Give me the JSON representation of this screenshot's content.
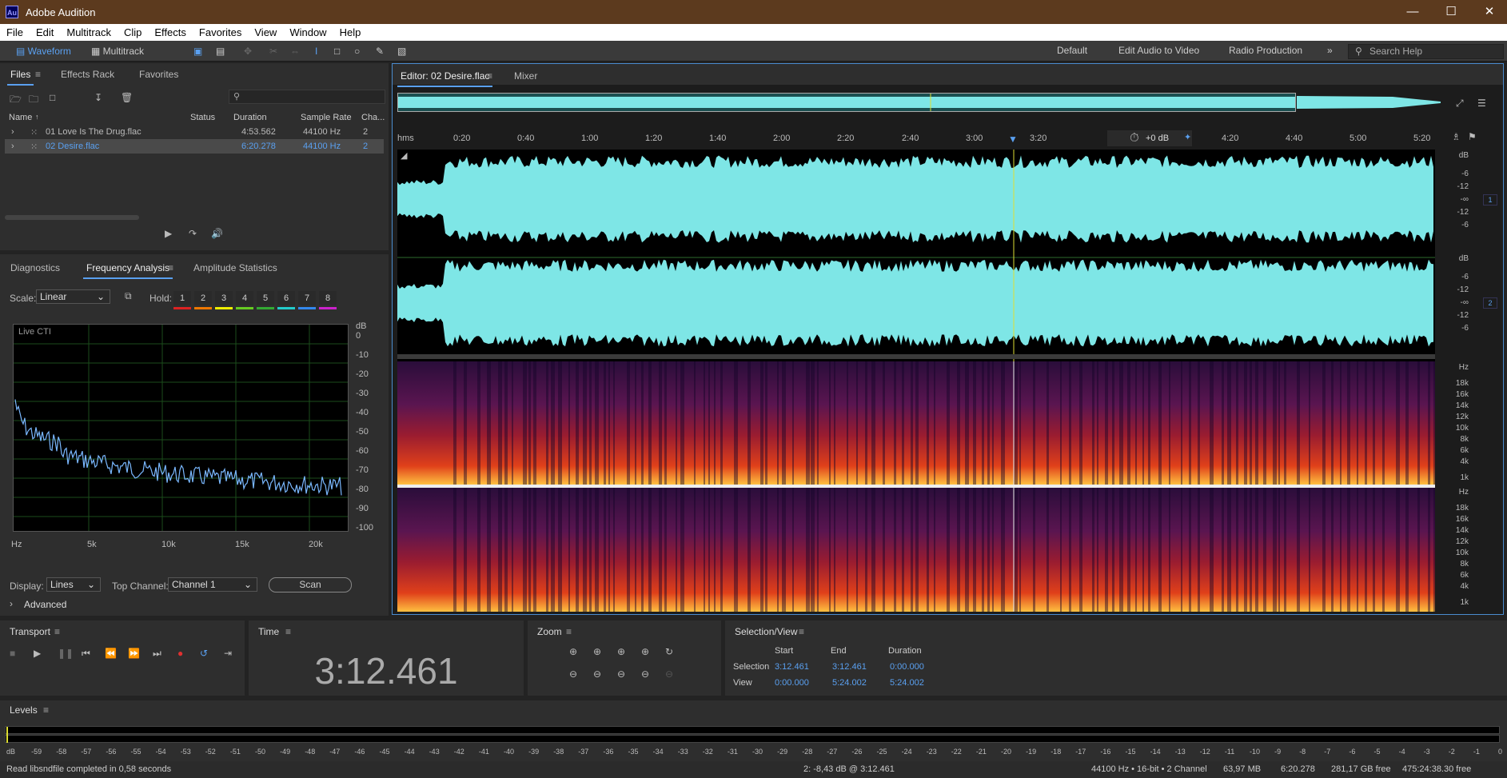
{
  "app": {
    "title": "Adobe Audition",
    "logo": "Au"
  },
  "menu": [
    "File",
    "Edit",
    "Multitrack",
    "Clip",
    "Effects",
    "Favorites",
    "View",
    "Window",
    "Help"
  ],
  "toolbar": {
    "waveform_label": "Waveform",
    "multitrack_label": "Multitrack",
    "workspaces": [
      "Default",
      "Edit Audio to Video",
      "Radio Production"
    ],
    "search_placeholder": "Search Help"
  },
  "files_panel": {
    "tabs": [
      "Files",
      "Effects Rack",
      "Favorites"
    ],
    "columns": [
      "Name",
      "Status",
      "Duration",
      "Sample Rate",
      "Cha..."
    ],
    "rows": [
      {
        "name": "01 Love Is The Drug.flac",
        "duration": "4:53.562",
        "rate": "44100 Hz",
        "ch": "2"
      },
      {
        "name": "02 Desire.flac",
        "duration": "6:20.278",
        "rate": "44100 Hz",
        "ch": "2"
      }
    ]
  },
  "analysis_panel": {
    "tabs": [
      "Diagnostics",
      "Frequency Analysis",
      "Amplitude Statistics"
    ],
    "scale_label": "Scale:",
    "scale_value": "Linear",
    "hold_label": "Hold:",
    "hold_buttons": [
      "1",
      "2",
      "3",
      "4",
      "5",
      "6",
      "7",
      "8"
    ],
    "hold_colors": [
      "#d22",
      "#e70",
      "#ee0",
      "#6c2",
      "#3a3",
      "#2cc",
      "#38e",
      "#c2c"
    ],
    "plot_label": "Live CTI",
    "db_ticks": [
      "dB",
      "0",
      "-10",
      "-20",
      "-30",
      "-40",
      "-50",
      "-60",
      "-70",
      "-80",
      "-90",
      "-100"
    ],
    "freq_ticks": [
      "Hz",
      "5k",
      "10k",
      "15k",
      "20k"
    ],
    "display_label": "Display:",
    "display_value": "Lines",
    "channel_label": "Top Channel:",
    "channel_value": "Channel 1",
    "scan_label": "Scan",
    "advanced_label": "Advanced"
  },
  "editor": {
    "tabs": [
      "Editor: 02 Desire.flac",
      "Mixer"
    ],
    "ruler": [
      "hms",
      "0:20",
      "0:40",
      "1:00",
      "1:20",
      "1:40",
      "2:00",
      "2:20",
      "2:40",
      "3:00",
      "3:20",
      "4:20",
      "4:40",
      "5:00",
      "5:20"
    ],
    "gain_label": "+0 dB",
    "db_scale": [
      "dB",
      "-6",
      "-12",
      "-∞",
      "-12",
      "-6"
    ],
    "hz_scale": [
      "Hz",
      "18k",
      "16k",
      "14k",
      "12k",
      "10k",
      "8k",
      "6k",
      "4k",
      "1k"
    ],
    "channel_numbers": [
      "1",
      "2"
    ]
  },
  "transport": {
    "title": "Transport"
  },
  "time": {
    "title": "Time",
    "value": "3:12.461"
  },
  "zoom": {
    "title": "Zoom"
  },
  "selection_view": {
    "title": "Selection/View",
    "headers": [
      "Start",
      "End",
      "Duration"
    ],
    "selection": {
      "label": "Selection",
      "start": "3:12.461",
      "end": "3:12.461",
      "duration": "0:00.000"
    },
    "view": {
      "label": "View",
      "start": "0:00.000",
      "end": "5:24.002",
      "duration": "5:24.002"
    }
  },
  "levels": {
    "title": "Levels",
    "ticks": [
      "dB",
      "-59",
      "-58",
      "-57",
      "-56",
      "-55",
      "-54",
      "-53",
      "-52",
      "-51",
      "-50",
      "-49",
      "-48",
      "-47",
      "-46",
      "-45",
      "-44",
      "-43",
      "-42",
      "-41",
      "-40",
      "-39",
      "-38",
      "-37",
      "-36",
      "-35",
      "-34",
      "-33",
      "-32",
      "-31",
      "-30",
      "-29",
      "-28",
      "-27",
      "-26",
      "-25",
      "-24",
      "-23",
      "-22",
      "-21",
      "-20",
      "-19",
      "-18",
      "-17",
      "-16",
      "-15",
      "-14",
      "-13",
      "-12",
      "-11",
      "-10",
      "-9",
      "-8",
      "-7",
      "-6",
      "-5",
      "-4",
      "-3",
      "-2",
      "-1",
      "0"
    ]
  },
  "status": {
    "message": "Read libsndfile completed in 0,58 seconds",
    "cursor": "2: -8,43 dB @ 3:12.461",
    "format": "44100 Hz • 16-bit • 2 Channel",
    "size": "63,97 MB",
    "duration": "6:20.278",
    "free": "281,17 GB free",
    "free_time": "475:24:38.30 free"
  },
  "colors": {
    "accent": "#5aa0f0",
    "waveform": "#7ee6e6",
    "titlebar": "#5c3a1e"
  }
}
